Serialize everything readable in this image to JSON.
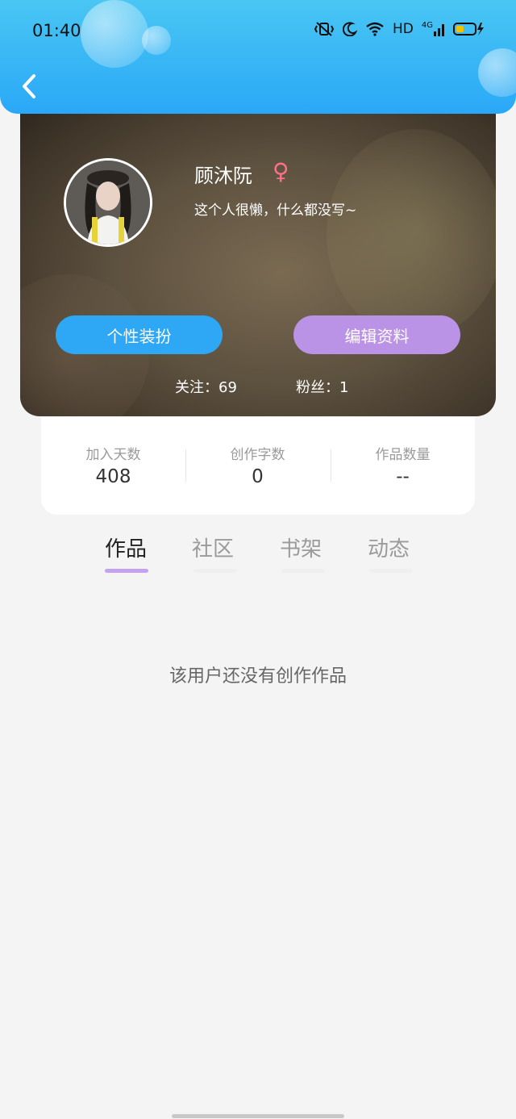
{
  "status_bar": {
    "time": "01:40",
    "network": "HD",
    "signal_label": "4G"
  },
  "profile": {
    "name": "顾沐阮",
    "gender_symbol": "♀",
    "bio": "这个人很懒，什么都没写~",
    "buttons": {
      "style": "个性装扮",
      "edit": "编辑资料"
    },
    "follow_text": "关注：69",
    "fans_text": "粉丝：1"
  },
  "stats": [
    {
      "label": "加入天数",
      "value": "408"
    },
    {
      "label": "创作字数",
      "value": "0"
    },
    {
      "label": "作品数量",
      "value": "--"
    }
  ],
  "tabs": [
    {
      "label": "作品",
      "active": true
    },
    {
      "label": "社区",
      "active": false
    },
    {
      "label": "书架",
      "active": false
    },
    {
      "label": "动态",
      "active": false
    }
  ],
  "empty_message": "该用户还没有创作作品",
  "colors": {
    "header": "#2aa8f7",
    "style_button": "#2ea7f5",
    "edit_button": "#bb93e6",
    "tab_indicator": "#c3a3ee",
    "gender": "#ff6f88"
  }
}
